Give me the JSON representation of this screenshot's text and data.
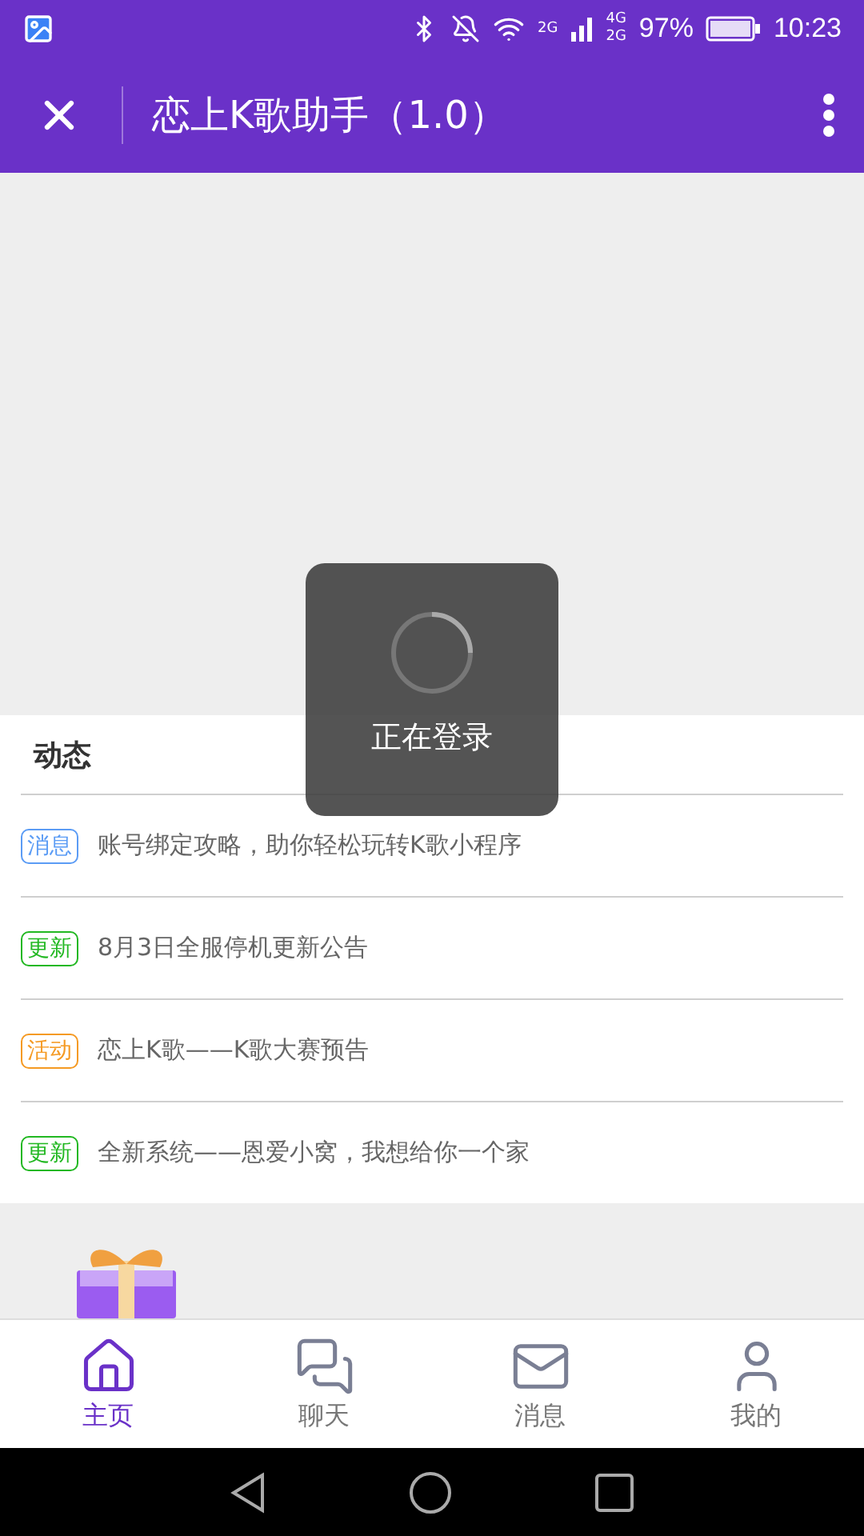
{
  "status_bar": {
    "wifi_label": "2G",
    "network_top": "4G",
    "network_bottom": "2G",
    "battery": "97%",
    "time": "10:23"
  },
  "app_bar": {
    "title": "恋上K歌助手（1.0）"
  },
  "news": {
    "title": "动态",
    "items": [
      {
        "tag": "消息",
        "color": "#5b9cf5",
        "text": "账号绑定攻略，助你轻松玩转K歌小程序"
      },
      {
        "tag": "更新",
        "color": "#22b822",
        "text": "8月3日全服停机更新公告"
      },
      {
        "tag": "活动",
        "color": "#f59a23",
        "text": "恋上K歌——K歌大赛预告"
      },
      {
        "tag": "更新",
        "color": "#22b822",
        "text": "全新系统——恩爱小窝，我想给你一个家"
      }
    ]
  },
  "toast": {
    "text": "正在登录"
  },
  "tabs": [
    {
      "kind": "home",
      "label": "主页",
      "selected": true
    },
    {
      "kind": "chat",
      "label": "聊天",
      "selected": false
    },
    {
      "kind": "mail",
      "label": "消息",
      "selected": false
    },
    {
      "kind": "user",
      "label": "我的",
      "selected": false
    }
  ]
}
